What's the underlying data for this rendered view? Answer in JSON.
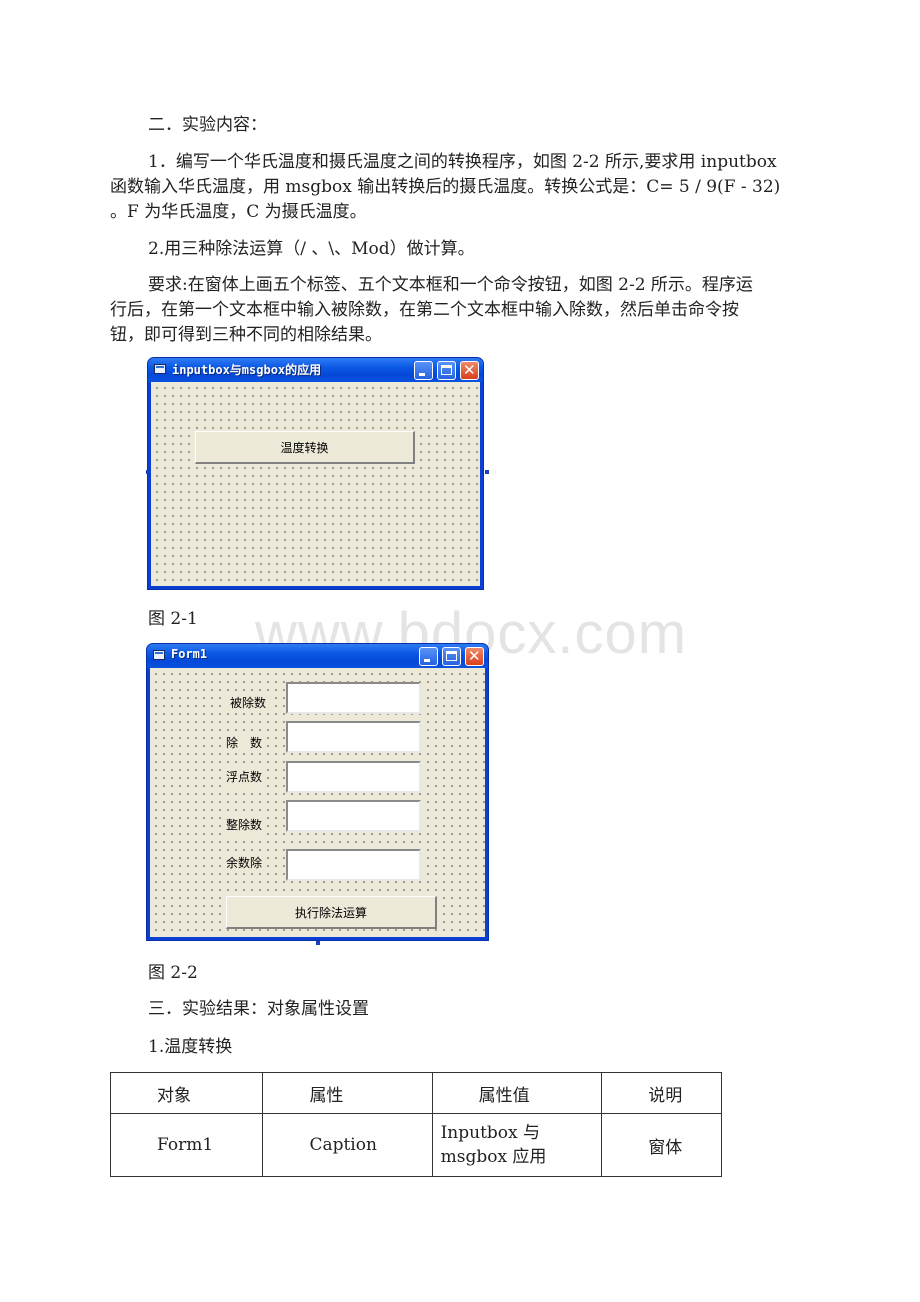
{
  "document": {
    "section2_heading": "二．实验内容：",
    "item1_line1": "1．编写一个华氏温度和摄氏温度之间的转换程序，如图 2-2 所示,要求用 inputbox",
    "item1_line2": "函数输入华氏温度，用 msgbox 输出转换后的摄氏温度。转换公式是：C= 5 / 9(F - 32)",
    "item1_line3": "。F 为华氏温度，C 为摄氏温度。",
    "item2": "2.用三种除法运算（/ 、\\、Mod）做计算。",
    "req_line1": "要求:在窗体上画五个标签、五个文本框和一个命令按钮，如图 2-2 所示。程序运",
    "req_line2": "行后，在第一个文本框中输入被除数，在第二个文本框中输入除数，然后单击命令按",
    "req_line3": "钮，即可得到三种不同的相除结果。",
    "fig1_caption": "图 2-1",
    "fig2_caption": "图 2-2",
    "section3_heading": "三．实验结果：对象属性设置",
    "sub1_heading": "1.温度转换",
    "watermark": "www.bdocx.com"
  },
  "figure1": {
    "window_title": "inputbox与msgbox的应用",
    "button_label": "温度转换"
  },
  "figure2": {
    "window_title": "Form1",
    "labels": [
      "被除数",
      "除　数",
      "浮点数",
      "整除数",
      "余数除"
    ],
    "textboxes": [
      "",
      "",
      "",
      "",
      ""
    ],
    "button_label": "执行除法运算"
  },
  "window_controls": {
    "minimize": "minimize-icon",
    "maximize": "maximize-icon",
    "close": "close-icon"
  },
  "table": {
    "headers": [
      "对象",
      "属性",
      "属性值",
      "说明"
    ],
    "rows": [
      [
        "Form1",
        "Caption",
        "Inputbox 与\nmsgbox 应用",
        "窗体"
      ]
    ]
  }
}
